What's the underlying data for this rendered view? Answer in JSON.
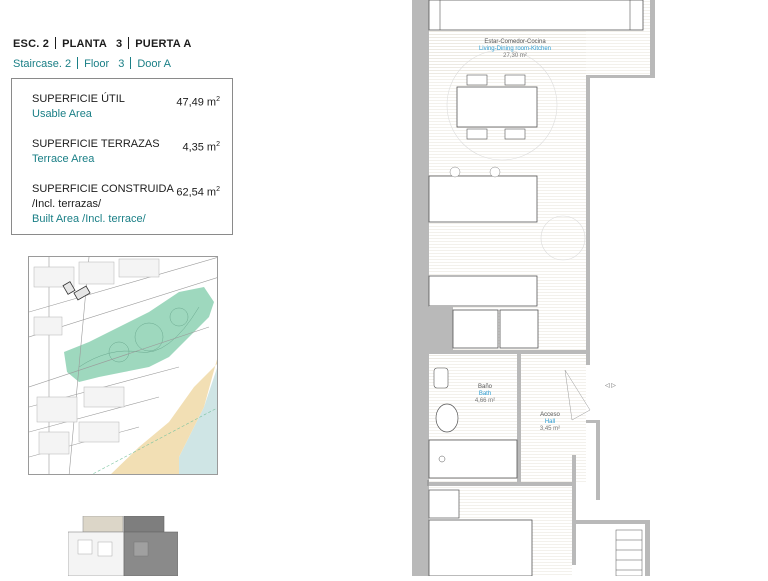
{
  "header": {
    "es": {
      "esc_label": "ESC.",
      "esc_value": "2",
      "planta_label": "PLANTA",
      "planta_value": "3",
      "puerta_label": "PUERTA",
      "puerta_value": "A"
    },
    "en": {
      "staircase_label": "Staircase.",
      "staircase_value": "2",
      "floor_label": "Floor",
      "floor_value": "3",
      "door_label": "Door",
      "door_value": "A"
    }
  },
  "areas": [
    {
      "es": "SUPERFICIE ÚTIL",
      "en": "Usable Area",
      "value": "47,49 m",
      "unit_sup": "2"
    },
    {
      "es": "SUPERFICIE TERRAZAS",
      "en": "Terrace Area",
      "value": "4,35 m",
      "unit_sup": "2"
    },
    {
      "es": "SUPERFICIE CONSTRUIDA",
      "es2": "/Incl. terrazas/",
      "en": "Built Area /Incl. terrace/",
      "value": "62,54 m",
      "unit_sup": "2"
    }
  ],
  "rooms": {
    "living": {
      "es": "Estar-Comedor-Cocina",
      "en": "Living-Dining room-Kitchen",
      "area": "27,30 m²"
    },
    "bath": {
      "es": "Baño",
      "en": "Bath",
      "area": "4,66 m²"
    },
    "hall": {
      "es": "Acceso",
      "en": "Hall",
      "area": "3,45 m²"
    }
  },
  "colors": {
    "teal": "#1a7f86",
    "park": "#9ed8be",
    "beach": "#f2dfb4",
    "sea": "#cfe5e5",
    "label_blue": "#2a9bd1"
  }
}
